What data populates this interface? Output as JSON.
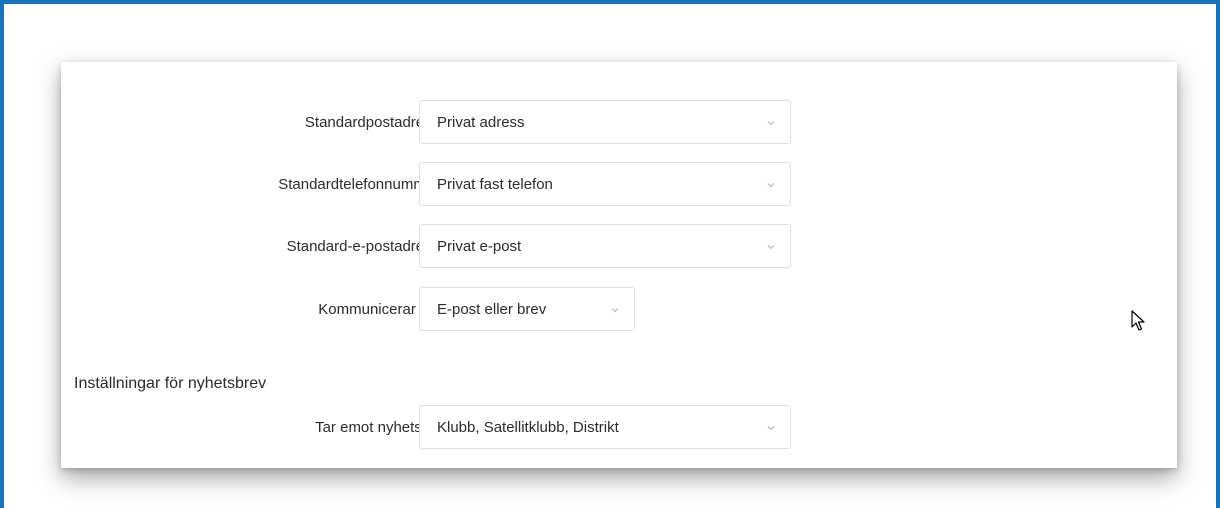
{
  "form": {
    "rows": [
      {
        "label": "Standardpostadress",
        "required": "*",
        "value": "Privat adress"
      },
      {
        "label": "Standardtelefonnummer",
        "required": "*",
        "value": "Privat fast telefon"
      },
      {
        "label": "Standard-e-postadress",
        "required": "*",
        "value": "Privat e-post"
      },
      {
        "label": "Kommunicerar via",
        "required": "*",
        "value": "E-post eller brev"
      }
    ],
    "newsletter_section": {
      "title": "Inställningar för nyhetsbrev",
      "label": "Tar emot nyhetsbrev",
      "value": "Klubb, Satellitklubb, Distrikt"
    }
  },
  "icons": {
    "dropdown": "chevron-down-icon",
    "cursor": "mouse-pointer-icon"
  },
  "colors": {
    "frame_border": "#1a73b8",
    "required_asterisk": "#b0222e",
    "text": "#2b2b2b",
    "field_border": "#e0e0e0"
  }
}
